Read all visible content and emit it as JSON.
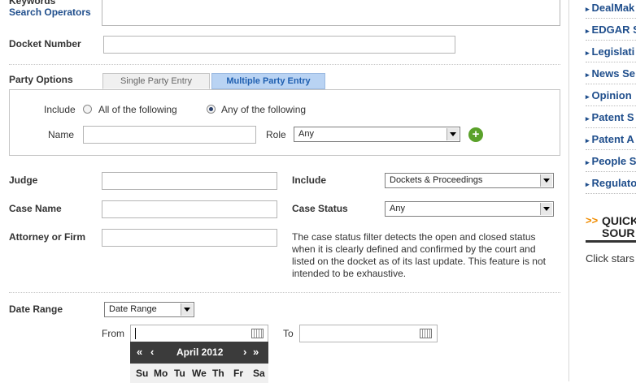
{
  "form": {
    "keywords_label": "Keywords",
    "search_operators_link": "Search Operators",
    "docket_number_label": "Docket Number",
    "party_options_label": "Party Options",
    "tabs": [
      {
        "label": "Single Party Entry",
        "active": true
      },
      {
        "label": "Multiple Party Entry",
        "active": false
      }
    ],
    "party": {
      "include_label": "Include",
      "radio_all": "All of the following",
      "radio_any": "Any of the following",
      "selected_radio": "Any of the following",
      "name_label": "Name",
      "role_label": "Role",
      "role_value": "Any"
    },
    "judge_label": "Judge",
    "case_name_label": "Case Name",
    "attorney_label": "Attorney or Firm",
    "include_label": "Include",
    "include_value": "Dockets & Proceedings",
    "case_status_label": "Case Status",
    "case_status_value": "Any",
    "case_status_note": "The case status filter detects the open and closed status when it is clearly defined and confirmed by the court and listed on the docket as of its last update. This feature is not intended to be exhaustive.",
    "date_range_label": "Date Range",
    "date_range_value": "Date Range",
    "from_label": "From",
    "to_label": "To"
  },
  "calendar": {
    "prev_year": "«",
    "prev_month": "‹",
    "month_year": "April 2012",
    "next_month": "›",
    "next_year": "»",
    "weekdays": [
      "Su",
      "Mo",
      "Tu",
      "We",
      "Th",
      "Fr",
      "Sa"
    ]
  },
  "sidebar": {
    "items": [
      "DealMak",
      "EDGAR S",
      "Legislati",
      "News Se",
      "Opinion",
      "Patent S",
      "Patent A",
      "People S",
      "Regulato"
    ],
    "quick_line1": "QUICK",
    "quick_line2": "SOUR",
    "quick_arrows": ">>",
    "click_text": "Click stars"
  },
  "colors": {
    "link": "#1f4e8c",
    "tab_active_bg": "#f0f0f0",
    "tab_inactive_bg": "#b9d3f3",
    "add_icon": "#5aa12a",
    "quick_arrows": "#f08c00"
  },
  "icons": [
    "add-icon",
    "calendar-icon",
    "dropdown-arrow-icon",
    "triangle-bullet-icon"
  ]
}
